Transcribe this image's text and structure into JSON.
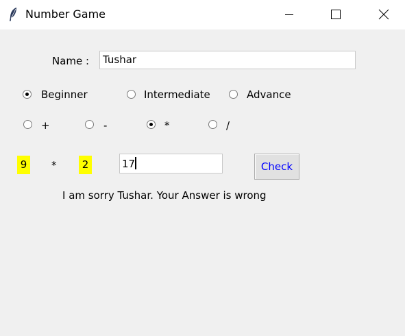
{
  "window": {
    "title": "Number Game",
    "controls": {
      "minimize": "minimize-icon",
      "maximize": "maximize-icon",
      "close": "close-icon"
    }
  },
  "form": {
    "name_label": "Name :",
    "name_value": "Tushar"
  },
  "difficulty": {
    "options": [
      "Beginner",
      "Intermediate",
      "Advance"
    ],
    "selected": "Beginner"
  },
  "operation": {
    "options": [
      "+",
      "-",
      "*",
      "/"
    ],
    "selected": "*"
  },
  "question": {
    "num1": "9",
    "operator": "*",
    "num2": "2",
    "answer_value": "17",
    "check_label": "Check"
  },
  "result": {
    "message": "I am sorry Tushar. Your Answer is wrong"
  },
  "colors": {
    "background": "#f0f0f0",
    "number_highlight": "#ffff00",
    "check_text": "#0000ff"
  }
}
